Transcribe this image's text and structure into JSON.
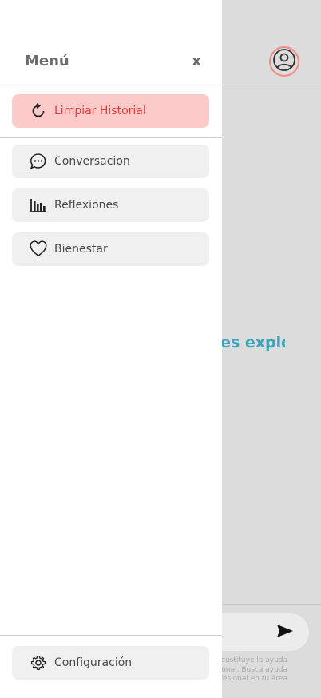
{
  "background": {
    "question_text": "¿Qué quieres explorar hoy?",
    "input_placeholder": "",
    "disclaimer": "Esta app no sustituye la ayuda profesional. Busca ayuda profesional en tu área"
  },
  "drawer": {
    "title": "Menú",
    "close_label": "x",
    "items": [
      {
        "label": "Limpiar Historial",
        "icon": "refresh-icon",
        "variant": "danger"
      },
      {
        "label": "Conversacion",
        "icon": "chat-bubble-icon"
      },
      {
        "label": "Reflexiones",
        "icon": "bar-chart-icon"
      },
      {
        "label": "Bienestar",
        "icon": "heart-icon"
      }
    ],
    "footer_item": {
      "label": "Configuración",
      "icon": "gear-icon"
    }
  },
  "colors": {
    "danger_bg": "#fdcaca",
    "danger_text": "#e53935",
    "accent": "#3aa6bd",
    "avatar_ring": "#f28b82"
  }
}
